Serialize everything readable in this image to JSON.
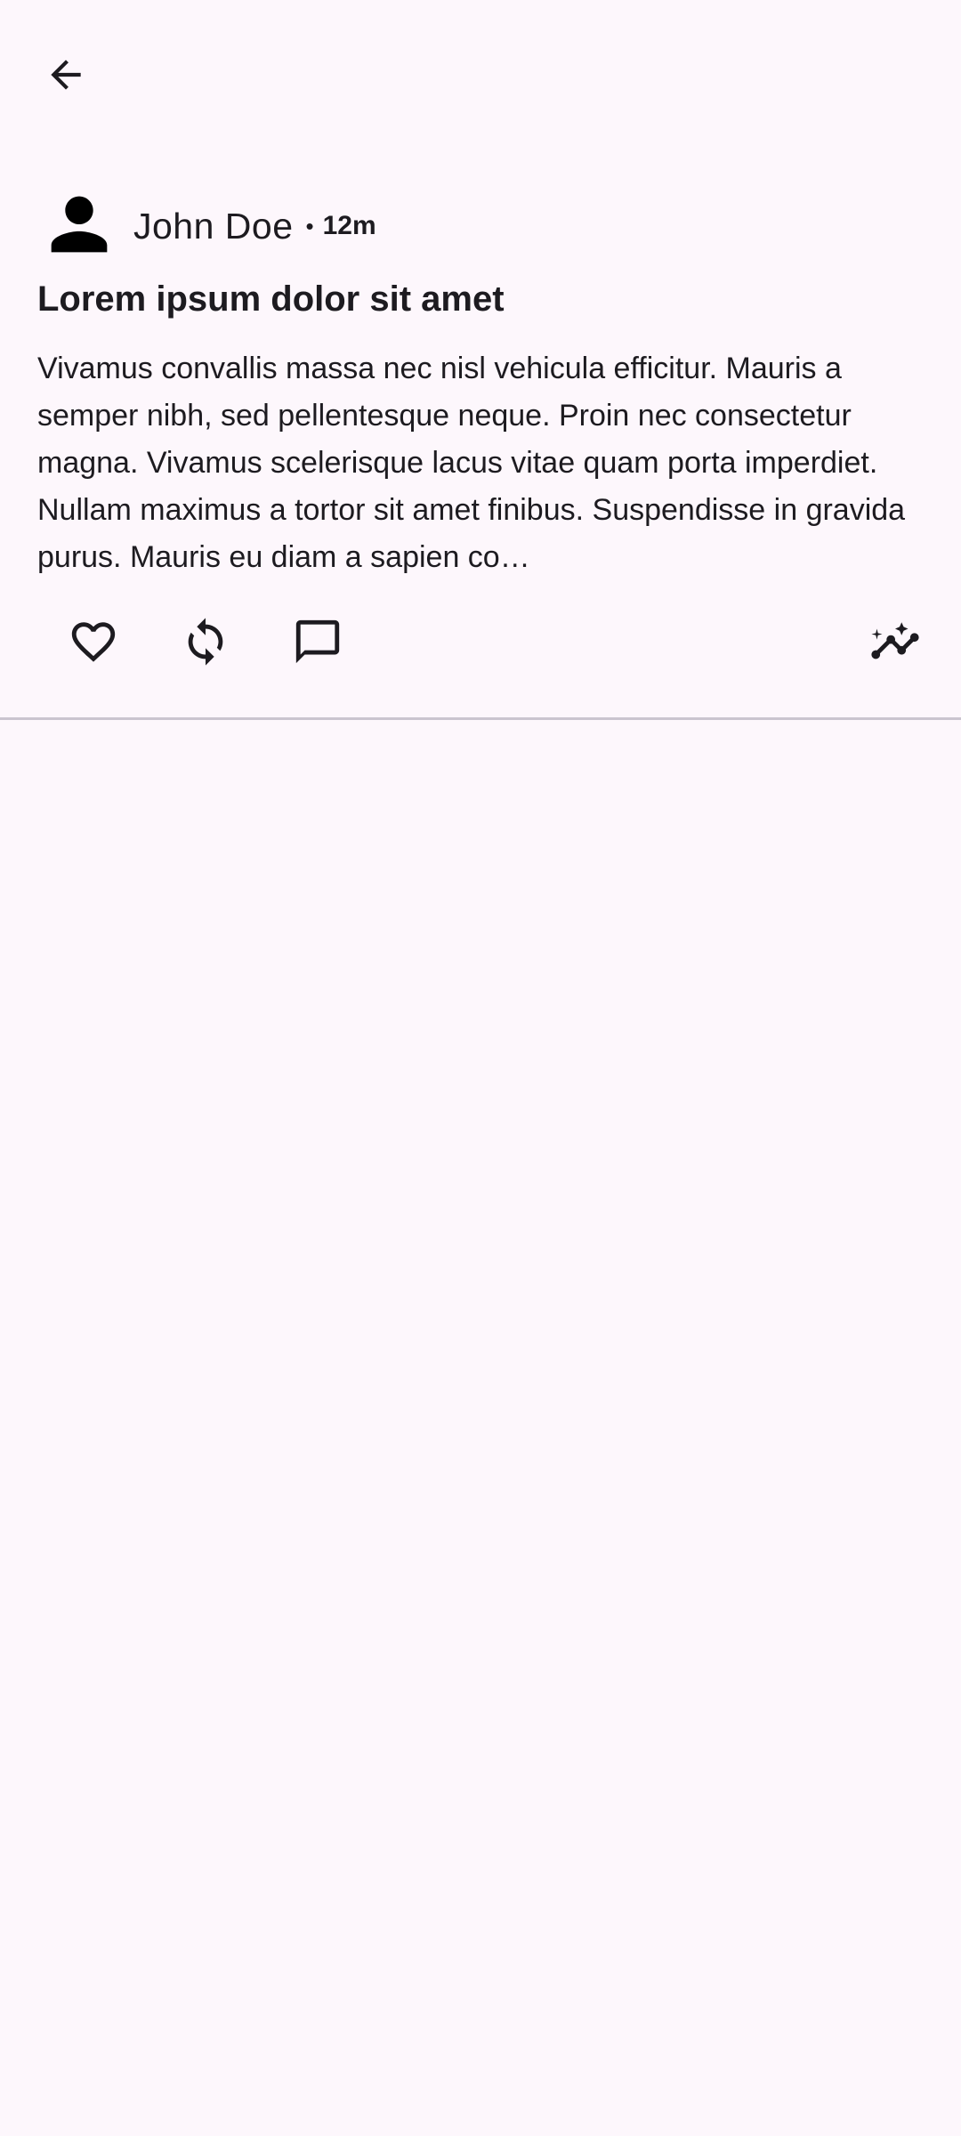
{
  "colors": {
    "background": "#fdf7fc",
    "text": "#1d1b20",
    "divider": "#cac4cf"
  },
  "icons": {
    "back": "arrow-back-icon",
    "avatar": "person-icon",
    "like": "heart-outline-icon",
    "repost": "sync-icon",
    "comment": "chat-bubble-outline-icon",
    "insights": "insights-icon"
  },
  "post": {
    "author": "John Doe",
    "separator": "•",
    "time": "12m",
    "title": "Lorem ipsum dolor sit amet",
    "body": "Vivamus convallis massa nec nisl vehicula efficitur. Mauris a semper nibh, sed pellentesque neque. Proin nec consectetur magna. Vivamus scelerisque lacus vitae quam porta imperdiet. Nullam maximus a tortor sit amet finibus. Suspendisse in gravida purus. Mauris eu diam a sapien co…"
  }
}
